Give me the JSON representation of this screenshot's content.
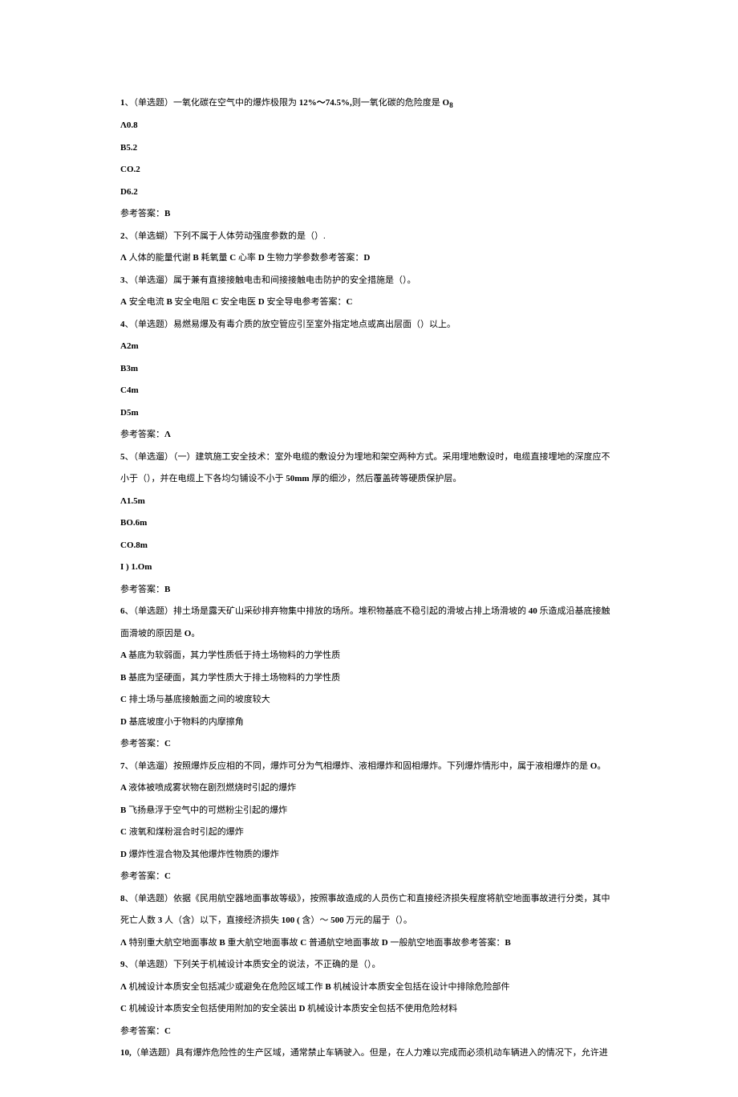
{
  "lines": [
    {
      "html": "<span class='bold'>1</span>、（单选题）一氧化碳在空气中的爆炸极限为 <span class='bold'>12%〜74.5%,</span>则一氧化碳的危险度是 <span class='bold'>O<sub>8</sub></span>"
    },
    {
      "html": "<span class='bold'>Λ0.8</span>"
    },
    {
      "html": "<span class='bold'>B5.2</span>"
    },
    {
      "html": "<span class='bold'>CO.2</span>"
    },
    {
      "html": "<span class='bold'>D6.2</span>"
    },
    {
      "html": "参考答案：<span class='bold'>B</span>"
    },
    {
      "html": "<span class='bold'>2</span>、（单选蝴）下列不属于人体劳动强度参数的是（）."
    },
    {
      "html": "<span class='bold'>Λ</span> 人体的能量代谢 <span class='bold'>B</span> 耗氧量 <span class='bold'>C</span> 心率 <span class='bold'>D</span> 生物力学参数参考答案：<span class='bold'>D</span>"
    },
    {
      "html": "<span class='bold'>3</span>、（单选遛）属于兼有直接接触电击和间接接触电击防护的安全措施是（）。"
    },
    {
      "html": "<span class='bold'>A</span> 安全电流 <span class='bold'>B</span> 安全电阻 <span class='bold'>C</span> 安全电医 <span class='bold'>D</span> 安全导电参考答案：<span class='bold'>C</span>"
    },
    {
      "html": "<span class='bold'>4</span>、（单选题）易燃易爆及有毒介质的放空管应引至室外指定地点或高出层面（）以上。"
    },
    {
      "html": "<span class='bold'>A2m</span>"
    },
    {
      "html": "<span class='bold'>B3m</span>"
    },
    {
      "html": "<span class='bold'>C4m</span>"
    },
    {
      "html": "<span class='bold'>D5m</span>"
    },
    {
      "html": "参考答案：<span class='bold'>Λ</span>"
    },
    {
      "html": "<span class='bold'>5</span>、（单选遛）（一）建筑施工安全技术：室外电缆的敷设分为埋地和架空两种方式。采用埋地敷设时，电缆直接埋地的深度应不小于（），并在电缆上下各均匀铺设不小于 <span class='bold'>50mm </span>厚的细沙，然后覆盖砖等硬质保护层。"
    },
    {
      "html": "<span class='bold'>Λ1.5m</span>"
    },
    {
      "html": "<span class='bold'>BO.6m</span>"
    },
    {
      "html": "<span class='bold'>CO.8m</span>"
    },
    {
      "html": "<span class='bold'>I ) 1.Om</span>"
    },
    {
      "html": "参考答案：<span class='bold'>B</span>"
    },
    {
      "html": "<span class='bold'>6</span>、（单选题）排土场是露天矿山采砂排弃物集中排放的场所。堆积物基底不稳引起的滑坡占排上场滑坡的 <span class='bold'>40 </span>乐造成沿基底接触面滑坡的原因是 <span class='bold'>O</span>。"
    },
    {
      "html": "<span class='bold'>A </span>基底为软弱面，其力学性质低于持土场物料的力学性质"
    },
    {
      "html": "<span class='bold'>B </span>基底为坚硬面，其力学性质大于排土场物料的力学性质"
    },
    {
      "html": "<span class='bold'>C </span>排土场与基底接触面之间的坡度较大"
    },
    {
      "html": "<span class='bold'>D </span>基底坡度小于物料的内摩擦角"
    },
    {
      "html": "参考答案：<span class='bold'>C</span>"
    },
    {
      "html": "<span class='bold'>7</span>、（单选遛）按照爆炸反应相的不同，爆炸可分为气相爆炸、液相爆炸和固相爆炸。下列爆炸情形中，属于液相爆炸的是 <span class='bold'>O</span>。"
    },
    {
      "html": "<span class='bold'>A </span>液体被喷成雾状物在剧烈燃烧时引起的爆炸"
    },
    {
      "html": "<span class='bold'>B </span>飞扬悬浮于空气中的可燃粉尘引起的爆炸"
    },
    {
      "html": "<span class='bold'>C </span>液氧和煤粉混合时引起的爆炸"
    },
    {
      "html": "<span class='bold'>D </span>爆炸性混合物及其他爆炸性物质的爆炸"
    },
    {
      "html": "参考答案：<span class='bold'>C</span>"
    },
    {
      "html": "<span class='bold'>8</span>、（单选题）依据《民用航空器地面事故等级》，按照事故造成的人员伤亡和直接经济损失程度将航空地面事故进行分类，其中死亡人数 <span class='bold'>3 </span>人（含）以下，直接经济损失 <span class='bold'>100 ( </span>含）〜 <span class='bold'>500 </span>万元的届于（）。"
    },
    {
      "html": "<span class='bold'>Λ </span>特别重大航空地面事故 <span class='bold'>B </span>重大航空地面事故 <span class='bold'>C </span>普通航空地面事故 <span class='bold'>D </span>一般航空地面事故参考答案：<span class='bold'>B</span>"
    },
    {
      "html": "<span class='bold'>9</span>、（单选题）下列关于机械设计本质安全的说法，不正确的是（）。"
    },
    {
      "html": "<span class='bold'>Λ </span>机械设计本质安全包括减少或避免在危险区域工作 <span class='bold'>B </span>机械设计本质安全包括在设计中排除危险部件"
    },
    {
      "html": "<span class='bold'>C </span>机械设计本质安全包括使用附加的安全装出 <span class='bold'>D </span>机械设计本质安全包括不使用危险材料"
    },
    {
      "html": "参考答案：<span class='bold'>C</span>"
    },
    {
      "html": "<span class='bold'>10,</span>（单选题）具有爆炸危险性的生产区域，通常禁止车辆驶入。但是，在人力难以完成而必须机动车辆进入的情况下，允许进"
    }
  ]
}
